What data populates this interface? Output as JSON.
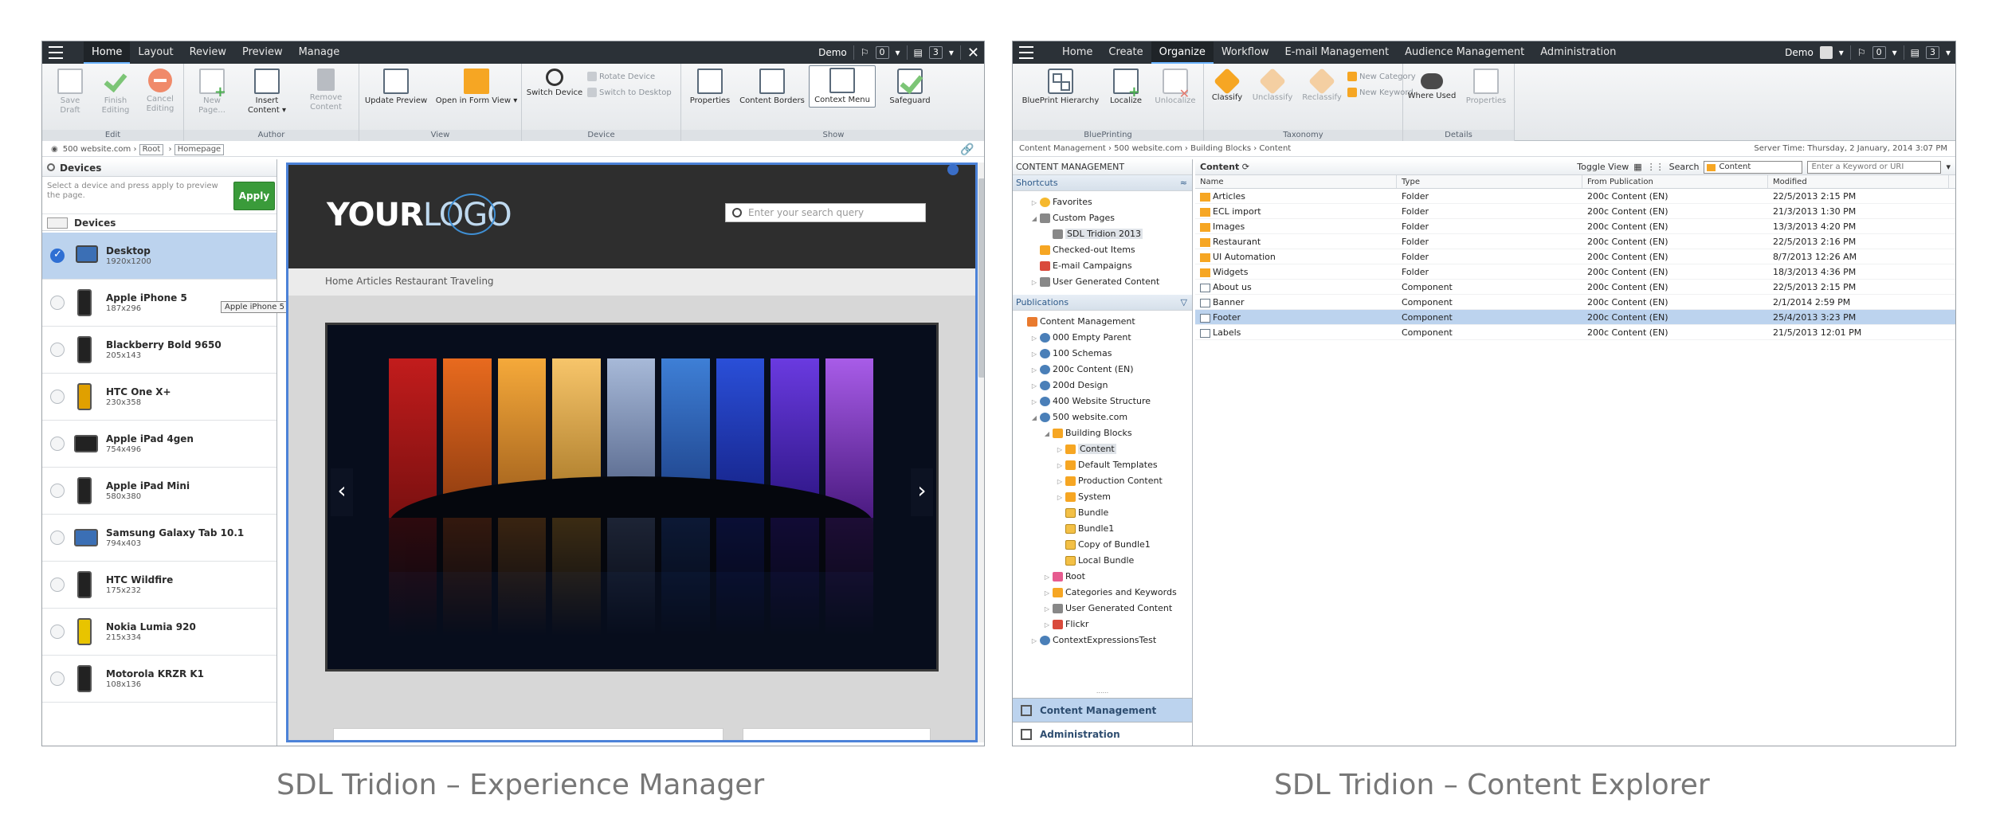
{
  "em": {
    "tabs": [
      "Home",
      "Layout",
      "Review",
      "Preview",
      "Manage"
    ],
    "user": "Demo",
    "flag_count": "0",
    "page_count": "3",
    "ribbon": {
      "edit": {
        "label": "Edit",
        "save": "Save Draft",
        "finish": "Finish Editing",
        "cancel": "Cancel Editing"
      },
      "author": {
        "label": "Author",
        "new_page": "New Page...",
        "insert": "Insert Content ▾",
        "remove": "Remove Content"
      },
      "view": {
        "label": "View",
        "update": "Update Preview",
        "open_form": "Open in Form View ▾"
      },
      "device": {
        "label": "Device",
        "switch": "Switch Device",
        "rotate": "Rotate Device",
        "desktop": "Switch to Desktop"
      },
      "show": {
        "label": "Show",
        "properties": "Properties",
        "borders": "Content Borders",
        "menu": "Context Menu",
        "safeguard": "Safeguard"
      }
    },
    "breadcrumb": [
      "500 website.com",
      "Root",
      "Homepage"
    ],
    "devices_title": "Devices",
    "hint": "Select a device and press apply to preview the page.",
    "apply": "Apply",
    "devices_sub": "Devices",
    "devices": [
      {
        "name": "Desktop",
        "size": "1920x1200"
      },
      {
        "name": "Apple iPhone 5",
        "size": "187x296"
      },
      {
        "name": "Blackberry Bold 9650",
        "size": "205x143"
      },
      {
        "name": "HTC One X+",
        "size": "230x358"
      },
      {
        "name": "Apple iPad 4gen",
        "size": "754x496"
      },
      {
        "name": "Apple iPad Mini",
        "size": "580x380"
      },
      {
        "name": "Samsung Galaxy Tab 10.1",
        "size": "794x403"
      },
      {
        "name": "HTC Wildfire",
        "size": "175x232"
      },
      {
        "name": "Nokia Lumia 920",
        "size": "215x334"
      },
      {
        "name": "Motorola KRZR K1",
        "size": "108x136"
      }
    ],
    "tooltip": "Apple iPhone 5 (Apple iPhone 5)",
    "preview": {
      "logo_bold": "YOUR",
      "logo_thin": "LOGO",
      "search_placeholder": "Enter your search query",
      "nav": "Home  Articles  Restaurant  Traveling",
      "prev": "‹",
      "next": "›"
    },
    "caption": "SDL Tridion – Experience Manager"
  },
  "ce": {
    "tabs": [
      "Home",
      "Create",
      "Organize",
      "Workflow",
      "E-mail Management",
      "Audience Management",
      "Administration"
    ],
    "user": "Demo",
    "flag_count": "0",
    "page_count": "3",
    "ribbon": {
      "blueprinting": {
        "label": "BluePrinting",
        "hierarchy": "BluePrint Hierarchy",
        "localize": "Localize",
        "unlocalize": "Unlocalize"
      },
      "taxonomy": {
        "label": "Taxonomy",
        "classify": "Classify",
        "unclassify": "Unclassify",
        "reclassify": "Reclassify",
        "new_category": "New Category",
        "new_keyword": "New Keyword"
      },
      "details": {
        "label": "Details",
        "where_used": "Where Used",
        "properties": "Properties"
      }
    },
    "breadcrumb": "Content Management  ›  500 website.com  ›  Building Blocks  ›  Content",
    "server_time": "Server Time: Thursday, 2 January, 2014 3:07 PM",
    "cm_header": "CONTENT MANAGEMENT",
    "shortcuts_header": "Shortcuts",
    "shortcuts": [
      {
        "label": "Favorites",
        "icon": "star",
        "level": 1,
        "exp": "▷"
      },
      {
        "label": "Custom Pages",
        "icon": "grey",
        "level": 1,
        "exp": "◢"
      },
      {
        "label": "SDL Tridion 2013",
        "icon": "grey",
        "level": 2,
        "exp": "",
        "hl": true
      },
      {
        "label": "Checked-out Items",
        "icon": "fold",
        "level": 1,
        "exp": ""
      },
      {
        "label": "E-mail Campaigns",
        "icon": "red",
        "level": 1,
        "exp": ""
      },
      {
        "label": "User Generated Content",
        "icon": "grey",
        "level": 1,
        "exp": "▷"
      }
    ],
    "publications_header": "Publications",
    "publications": [
      {
        "label": "Content Management",
        "icon": "cm",
        "level": 0,
        "exp": ""
      },
      {
        "label": "000 Empty Parent",
        "icon": "globe",
        "level": 1,
        "exp": "▷"
      },
      {
        "label": "100 Schemas",
        "icon": "globe",
        "level": 1,
        "exp": "▷"
      },
      {
        "label": "200c Content (EN)",
        "icon": "globe",
        "level": 1,
        "exp": "▷"
      },
      {
        "label": "200d Design",
        "icon": "globe",
        "level": 1,
        "exp": "▷"
      },
      {
        "label": "400 Website Structure",
        "icon": "globe",
        "level": 1,
        "exp": "▷"
      },
      {
        "label": "500 website.com",
        "icon": "globe",
        "level": 1,
        "exp": "◢"
      },
      {
        "label": "Building Blocks",
        "icon": "fold",
        "level": 2,
        "exp": "◢"
      },
      {
        "label": "Content",
        "icon": "fold",
        "level": 3,
        "exp": "▷",
        "hl": true
      },
      {
        "label": "Default Templates",
        "icon": "fold",
        "level": 3,
        "exp": "▷"
      },
      {
        "label": "Production Content",
        "icon": "fold",
        "level": 3,
        "exp": "▷"
      },
      {
        "label": "System",
        "icon": "fold",
        "level": 3,
        "exp": "▷"
      },
      {
        "label": "Bundle",
        "icon": "bundle",
        "level": 3,
        "exp": ""
      },
      {
        "label": "Bundle1",
        "icon": "bundle",
        "level": 3,
        "exp": ""
      },
      {
        "label": "Copy of Bundle1",
        "icon": "bundle",
        "level": 3,
        "exp": ""
      },
      {
        "label": "Local Bundle",
        "icon": "bundle",
        "level": 3,
        "exp": ""
      },
      {
        "label": "Root",
        "icon": "pfold",
        "level": 2,
        "exp": "▷"
      },
      {
        "label": "Categories and Keywords",
        "icon": "fold",
        "level": 2,
        "exp": "▷"
      },
      {
        "label": "User Generated Content",
        "icon": "grey",
        "level": 2,
        "exp": "▷"
      },
      {
        "label": "Flickr",
        "icon": "red",
        "level": 2,
        "exp": "▷"
      },
      {
        "label": "ContextExpressionsTest",
        "icon": "globe",
        "level": 1,
        "exp": "▷"
      }
    ],
    "nav_content": "Content Management",
    "nav_admin": "Administration",
    "list_title": "Content",
    "toggle_view": "Toggle View",
    "search_label": "Search",
    "search_scope": "Content",
    "keyword_placeholder": "Enter a Keyword or URI",
    "columns": [
      "Name",
      "Type",
      "From Publication",
      "Modified"
    ],
    "rows": [
      {
        "name": "Articles",
        "type": "Folder",
        "pub": "200c Content (EN)",
        "modified": "22/5/2013 2:15 PM",
        "icon": "fold"
      },
      {
        "name": "ECL import",
        "type": "Folder",
        "pub": "200c Content (EN)",
        "modified": "21/3/2013 1:30 PM",
        "icon": "fold"
      },
      {
        "name": "Images",
        "type": "Folder",
        "pub": "200c Content (EN)",
        "modified": "13/3/2013 4:20 PM",
        "icon": "fold"
      },
      {
        "name": "Restaurant",
        "type": "Folder",
        "pub": "200c Content (EN)",
        "modified": "22/5/2013 2:16 PM",
        "icon": "fold"
      },
      {
        "name": "UI Automation",
        "type": "Folder",
        "pub": "200c Content (EN)",
        "modified": "8/7/2013 12:26 AM",
        "icon": "fold"
      },
      {
        "name": "Widgets",
        "type": "Folder",
        "pub": "200c Content (EN)",
        "modified": "18/3/2013 4:36 PM",
        "icon": "fold"
      },
      {
        "name": "About us",
        "type": "Component",
        "pub": "200c Content (EN)",
        "modified": "22/5/2013 2:15 PM",
        "icon": "comp"
      },
      {
        "name": "Banner",
        "type": "Component",
        "pub": "200c Content (EN)",
        "modified": "2/1/2014 2:59 PM",
        "icon": "comp"
      },
      {
        "name": "Footer",
        "type": "Component",
        "pub": "200c Content (EN)",
        "modified": "25/4/2013 3:23 PM",
        "icon": "comp",
        "sel": true
      },
      {
        "name": "Labels",
        "type": "Component",
        "pub": "200c Content (EN)",
        "modified": "21/5/2013 12:01 PM",
        "icon": "comp"
      }
    ],
    "caption": "SDL Tridion – Content Explorer"
  }
}
